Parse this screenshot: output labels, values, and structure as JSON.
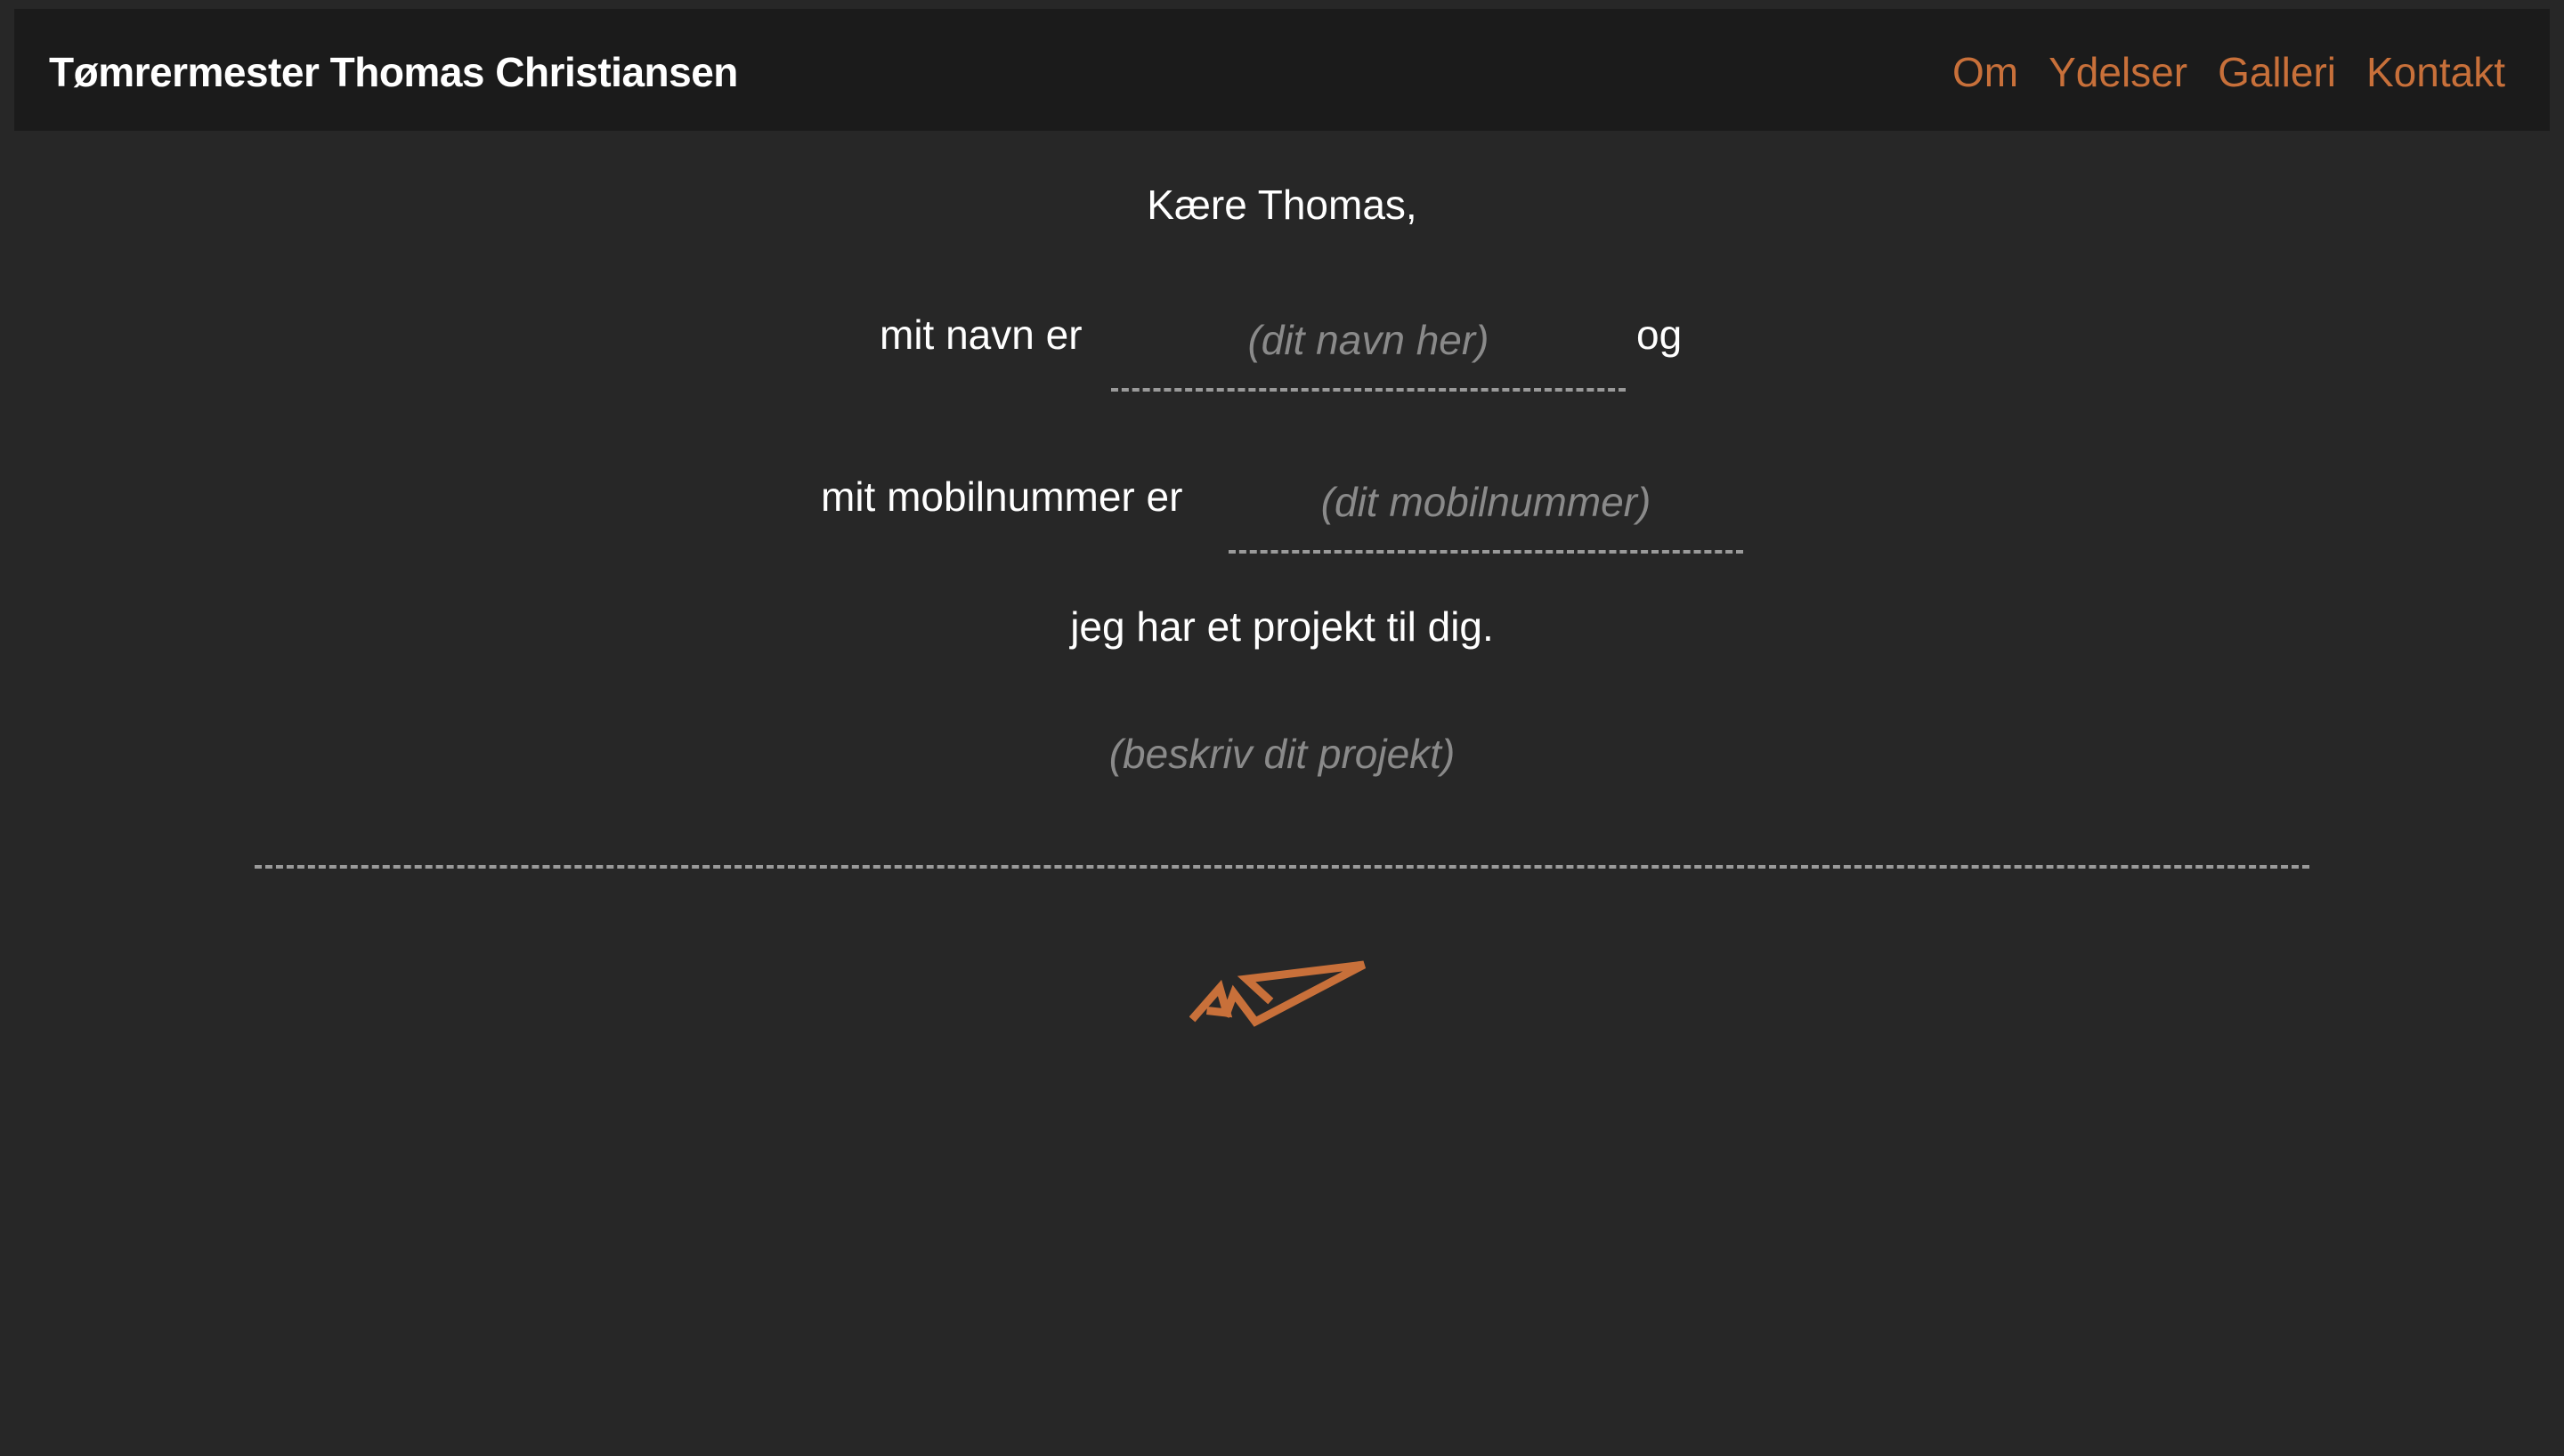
{
  "header": {
    "brand": "Tømrermester Thomas Christiansen",
    "nav": [
      {
        "label": "Om"
      },
      {
        "label": "Ydelser"
      },
      {
        "label": "Galleri"
      },
      {
        "label": "Kontakt"
      }
    ]
  },
  "letter": {
    "greeting": "Kære Thomas,",
    "name_label": "mit navn er",
    "name_placeholder": "(dit navn her)",
    "and_label": "og",
    "mobile_label": "mit mobilnummer er",
    "mobile_placeholder": "(dit mobilnummer)",
    "project_label": "jeg har et projekt til dig.",
    "project_placeholder": "(beskriv dit projekt)"
  },
  "send": {
    "icon": "paper-plane-icon",
    "color": "#c8703a"
  },
  "colors": {
    "background": "#272727",
    "header": "#1b1b1b",
    "accent": "#c8703a",
    "placeholder": "#8a8a8a"
  }
}
